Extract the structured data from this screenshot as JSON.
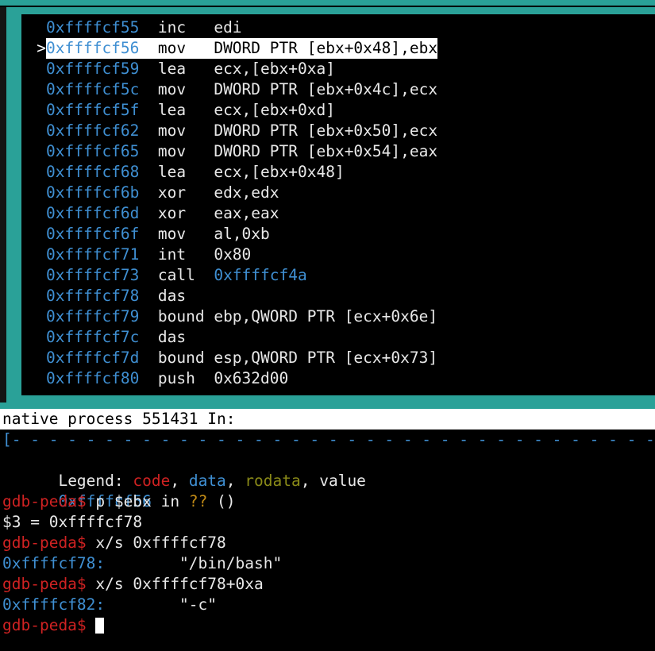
{
  "terminal": {
    "type": "gdb-peda-disassembly-terminal",
    "background": "#000000",
    "frame_color": "#2aa198",
    "colors": {
      "address_blue": "#3f8fd2",
      "prompt_red": "#cf2222",
      "rodata_olive": "#8a8a18",
      "unknown_amber": "#c08a16",
      "text_white": "#e8e8e8",
      "highlight_bg": "#ffffff"
    }
  },
  "disassembly": {
    "current_marker": ">",
    "lines": [
      {
        "marker": "",
        "address": "0xffffcf55",
        "mnemonic": "inc",
        "operands": "edi",
        "operand_is_address": false,
        "current": false
      },
      {
        "marker": ">",
        "address": "0xffffcf56",
        "mnemonic": "mov",
        "operands": "DWORD PTR [ebx+0x48],ebx",
        "operand_is_address": false,
        "current": true
      },
      {
        "marker": "",
        "address": "0xffffcf59",
        "mnemonic": "lea",
        "operands": "ecx,[ebx+0xa]",
        "operand_is_address": false,
        "current": false
      },
      {
        "marker": "",
        "address": "0xffffcf5c",
        "mnemonic": "mov",
        "operands": "DWORD PTR [ebx+0x4c],ecx",
        "operand_is_address": false,
        "current": false
      },
      {
        "marker": "",
        "address": "0xffffcf5f",
        "mnemonic": "lea",
        "operands": "ecx,[ebx+0xd]",
        "operand_is_address": false,
        "current": false
      },
      {
        "marker": "",
        "address": "0xffffcf62",
        "mnemonic": "mov",
        "operands": "DWORD PTR [ebx+0x50],ecx",
        "operand_is_address": false,
        "current": false
      },
      {
        "marker": "",
        "address": "0xffffcf65",
        "mnemonic": "mov",
        "operands": "DWORD PTR [ebx+0x54],eax",
        "operand_is_address": false,
        "current": false
      },
      {
        "marker": "",
        "address": "0xffffcf68",
        "mnemonic": "lea",
        "operands": "ecx,[ebx+0x48]",
        "operand_is_address": false,
        "current": false
      },
      {
        "marker": "",
        "address": "0xffffcf6b",
        "mnemonic": "xor",
        "operands": "edx,edx",
        "operand_is_address": false,
        "current": false
      },
      {
        "marker": "",
        "address": "0xffffcf6d",
        "mnemonic": "xor",
        "operands": "eax,eax",
        "operand_is_address": false,
        "current": false
      },
      {
        "marker": "",
        "address": "0xffffcf6f",
        "mnemonic": "mov",
        "operands": "al,0xb",
        "operand_is_address": false,
        "current": false
      },
      {
        "marker": "",
        "address": "0xffffcf71",
        "mnemonic": "int",
        "operands": "0x80",
        "operand_is_address": false,
        "current": false
      },
      {
        "marker": "",
        "address": "0xffffcf73",
        "mnemonic": "call",
        "operands": "0xffffcf4a",
        "operand_is_address": true,
        "current": false
      },
      {
        "marker": "",
        "address": "0xffffcf78",
        "mnemonic": "das",
        "operands": "",
        "operand_is_address": false,
        "current": false
      },
      {
        "marker": "",
        "address": "0xffffcf79",
        "mnemonic": "bound",
        "operands": "ebp,QWORD PTR [ecx+0x6e]",
        "operand_is_address": false,
        "current": false
      },
      {
        "marker": "",
        "address": "0xffffcf7c",
        "mnemonic": "das",
        "operands": "",
        "operand_is_address": false,
        "current": false
      },
      {
        "marker": "",
        "address": "0xffffcf7d",
        "mnemonic": "bound",
        "operands": "esp,QWORD PTR [ecx+0x73]",
        "operand_is_address": false,
        "current": false
      },
      {
        "marker": "",
        "address": "0xffffcf80",
        "mnemonic": "push",
        "operands": "0x632d00",
        "operand_is_address": false,
        "current": false
      }
    ]
  },
  "status_bar": {
    "text": "native process 551431 In:"
  },
  "separator": {
    "open_bracket": "[",
    "dash_unit": "- ",
    "repeat": 56
  },
  "legend": {
    "label": "Legend: ",
    "code": "code",
    "data": "data",
    "rodata": "rodata",
    "value": "value",
    "comma": ", "
  },
  "console": {
    "location_line": {
      "address": "0xffffcf56",
      "in_word": " in ",
      "unknown": "??",
      "parens": " ()"
    },
    "prompt": "gdb-peda$ ",
    "entries": [
      {
        "kind": "prompt",
        "command": "p $ebx"
      },
      {
        "kind": "output",
        "text": "$3 = 0xffffcf78"
      },
      {
        "kind": "prompt",
        "command": "x/s 0xffffcf78"
      },
      {
        "kind": "addrout",
        "address": "0xffffcf78:",
        "value": "        \"/bin/bash\""
      },
      {
        "kind": "prompt",
        "command": "x/s 0xffffcf78+0xa"
      },
      {
        "kind": "addrout",
        "address": "0xffffcf82:",
        "value": "        \"-c\""
      },
      {
        "kind": "cursor",
        "command": ""
      }
    ]
  }
}
